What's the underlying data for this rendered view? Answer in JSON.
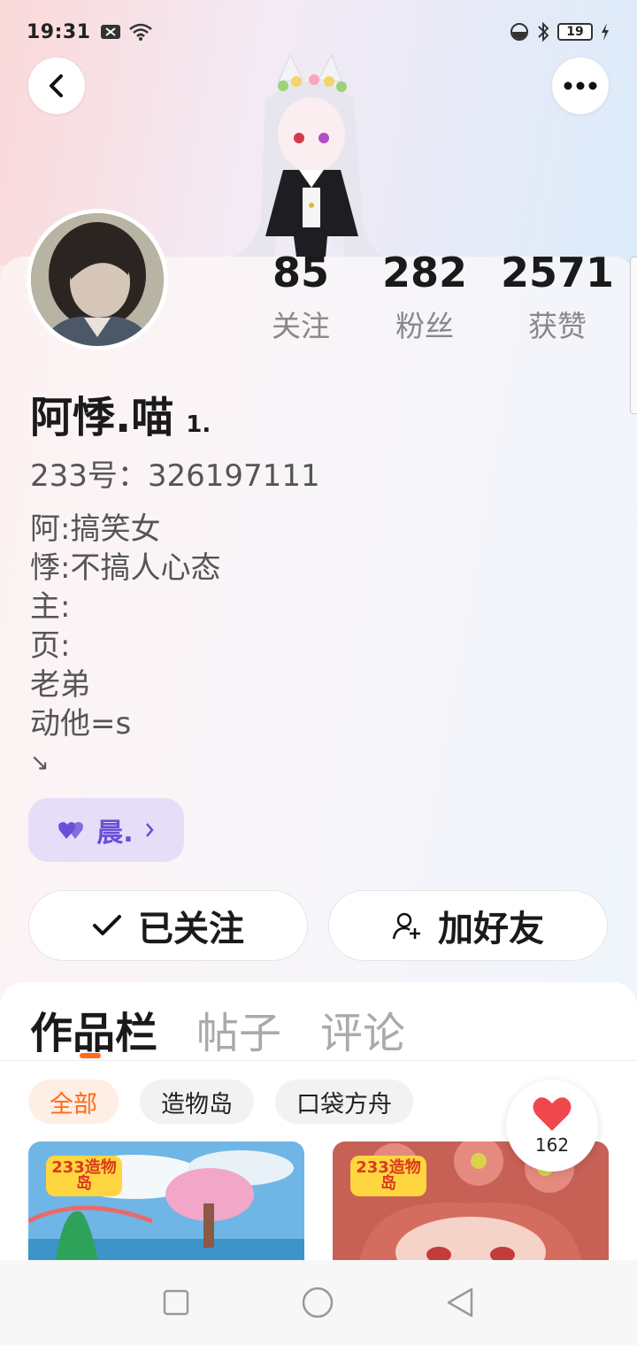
{
  "status_bar": {
    "time": "19:31",
    "battery": "19"
  },
  "profile": {
    "name": "阿悸.喵",
    "level": "1.",
    "uid": "233号：326197111",
    "bio": [
      "阿:搞笑女",
      "悸:不搞人心态",
      "主:",
      "页:",
      "老弟",
      "动他=s",
      "↘"
    ],
    "tag": "晨.",
    "stats": [
      {
        "value": "85",
        "label": "关注"
      },
      {
        "value": "282",
        "label": "粉丝"
      },
      {
        "value": "2571",
        "label": "获赞"
      }
    ]
  },
  "actions": {
    "following_label": "已关注",
    "add_friend_label": "加好友"
  },
  "tabs": [
    "作品栏",
    "帖子",
    "评论"
  ],
  "filters": [
    "全部",
    "造物岛",
    "口袋方舟"
  ],
  "cards": [
    {
      "badge": "233造物岛"
    },
    {
      "badge": "233造物岛"
    }
  ],
  "like": {
    "count": "162"
  },
  "colors": {
    "accent": "#ff6a1a",
    "tag_purple": "#6950d6",
    "heart_red": "#f0464d"
  }
}
